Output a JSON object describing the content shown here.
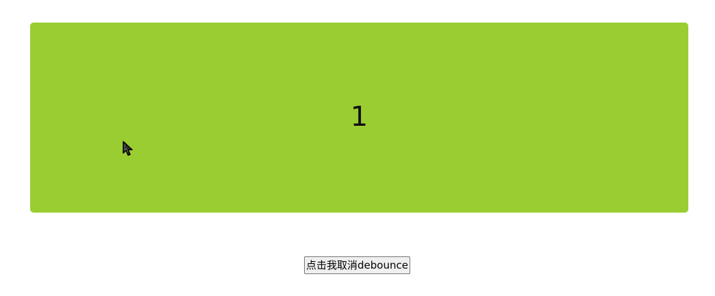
{
  "counter": {
    "value": "1",
    "background_color": "#9acd32"
  },
  "cursor": {
    "icon": "mouse-cursor-icon"
  },
  "actions": {
    "cancel_debounce_label": "点击我取消debounce"
  }
}
